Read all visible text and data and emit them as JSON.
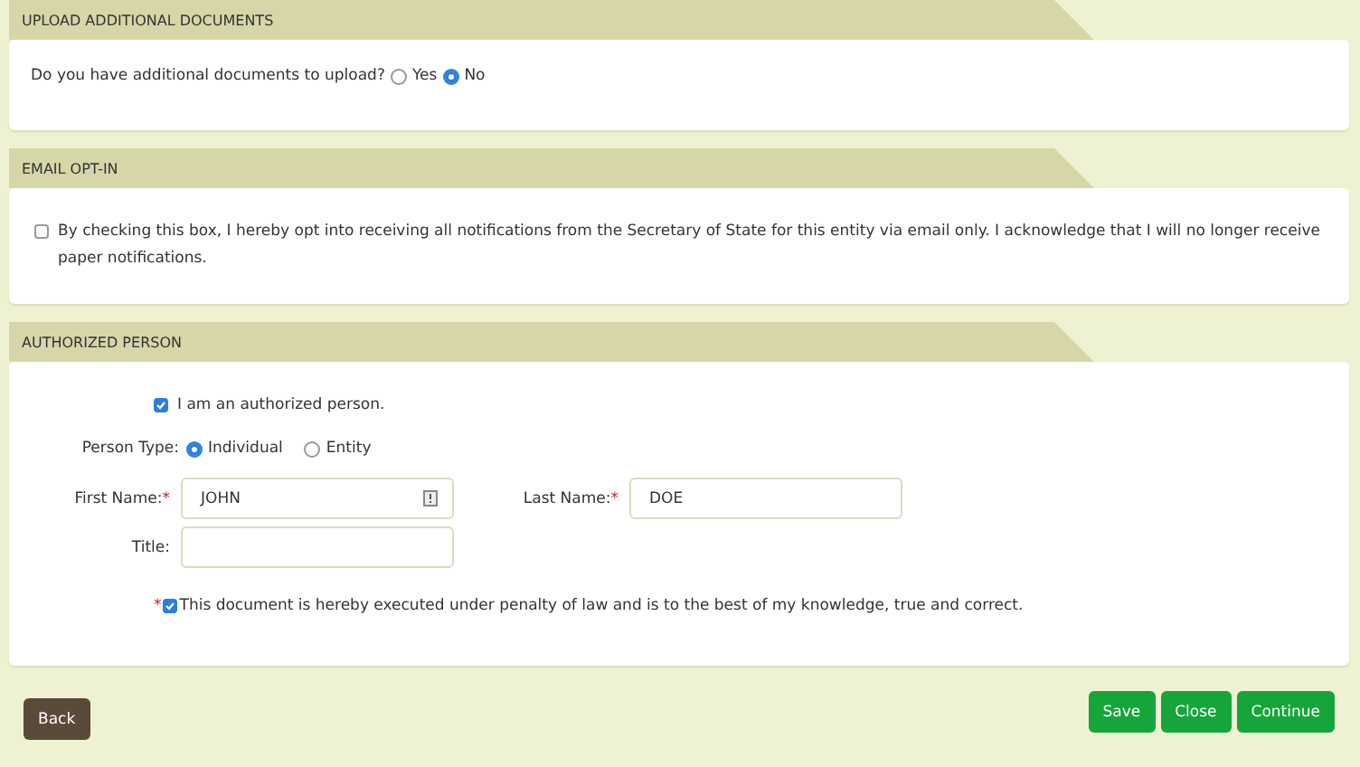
{
  "upload": {
    "title": "UPLOAD ADDITIONAL DOCUMENTS",
    "question": "Do you have additional documents to upload?",
    "options": [
      {
        "label": "Yes",
        "selected": false
      },
      {
        "label": "No",
        "selected": true
      }
    ]
  },
  "email": {
    "title": "EMAIL OPT-IN",
    "checkbox": {
      "checked": false,
      "label": "By checking this box, I hereby opt into receiving all notifications from the Secretary of State for this entity via email only. I acknowledge that I will no longer receive paper notifications."
    }
  },
  "authorized": {
    "title": "AUTHORIZED PERSON",
    "authorized_checkbox": {
      "checked": true,
      "label": "I am an authorized person."
    },
    "person_type": {
      "label": "Person Type:",
      "options": [
        {
          "label": "Individual",
          "selected": true
        },
        {
          "label": "Entity",
          "selected": false
        }
      ]
    },
    "fields": [
      {
        "label": "First Name:",
        "required_mark": "*",
        "value": "JOHN",
        "info_icon": true
      },
      {
        "label": "Last Name:",
        "required_mark": "*",
        "value": "DOE",
        "info_icon": false
      },
      {
        "label": "Title:",
        "info_icon": false
      }
    ],
    "declaration": {
      "required_mark": "*",
      "checked": true,
      "label": "This document is hereby executed under penalty of law and is to the best of my knowledge, true and correct."
    }
  },
  "buttons": [
    {
      "label": "Back",
      "kind": "back"
    },
    {
      "label": "Save",
      "kind": "primary"
    },
    {
      "label": "Close",
      "kind": "primary"
    },
    {
      "label": "Continue",
      "kind": "primary"
    }
  ]
}
